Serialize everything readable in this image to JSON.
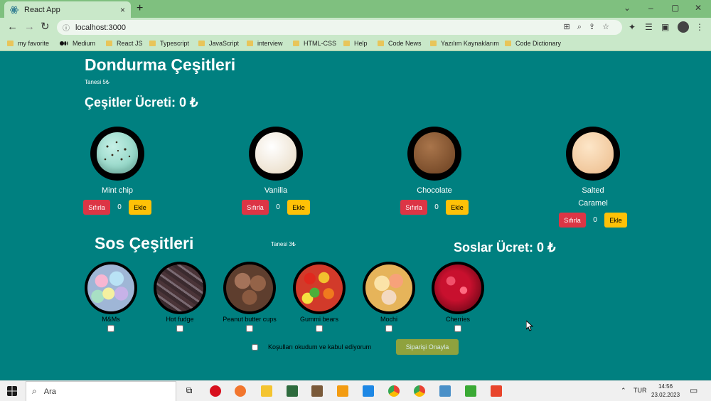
{
  "browser": {
    "tab_title": "React App",
    "tab_close": "×",
    "new_tab": "+",
    "url": "localhost:3000",
    "controls": {
      "minimize": "⌄",
      "restore": "–",
      "maximize": "▢",
      "close": "✕"
    },
    "bookmarks": [
      "my favorite",
      "Medium",
      "React JS",
      "Typescript",
      "JavaScript",
      "interview",
      "HTML-CSS",
      "Help",
      "Code News",
      "Yazılım Kaynaklarım",
      "Code Dictionary"
    ]
  },
  "page": {
    "title": "Dondurma Çeşitleri",
    "unit_price": "Tanesi 5₺",
    "flavors_total": "Çeşitler Ücreti: 0 ₺",
    "flavors": [
      {
        "name": "Mint chip",
        "count": "0",
        "color": "#9edccf"
      },
      {
        "name": "Vanilla",
        "count": "0",
        "color": "#f6efe4"
      },
      {
        "name": "Chocolate",
        "count": "0",
        "color": "#8a5a33"
      },
      {
        "name": "Salted Caramel",
        "count": "0",
        "color": "#f5d3ae"
      }
    ],
    "reset_label": "Sıfırla",
    "add_label": "Ekle",
    "toppings_title": "Sos Çeşitleri",
    "toppings_unit_price": "Tanesi 3₺",
    "toppings_total": "Soslar Ücret: 0 ₺",
    "toppings": [
      {
        "name": "M&Ms",
        "color": "#a9c8e8"
      },
      {
        "name": "Hot fudge",
        "color": "#5e4a4a"
      },
      {
        "name": "Peanut butter cups",
        "color": "#8c6046"
      },
      {
        "name": "Gummi bears",
        "color": "#d4882c"
      },
      {
        "name": "Mochi",
        "color": "#f0c060"
      },
      {
        "name": "Cherries",
        "color": "#c0102a"
      }
    ],
    "terms_label": "Koşulları okudum ve kabul ediyorum",
    "confirm_label": "Siparişi Onayla"
  },
  "taskbar": {
    "search_placeholder": "Ara",
    "lang": "TUR",
    "time": "14:56",
    "date": "23.02.2023"
  }
}
